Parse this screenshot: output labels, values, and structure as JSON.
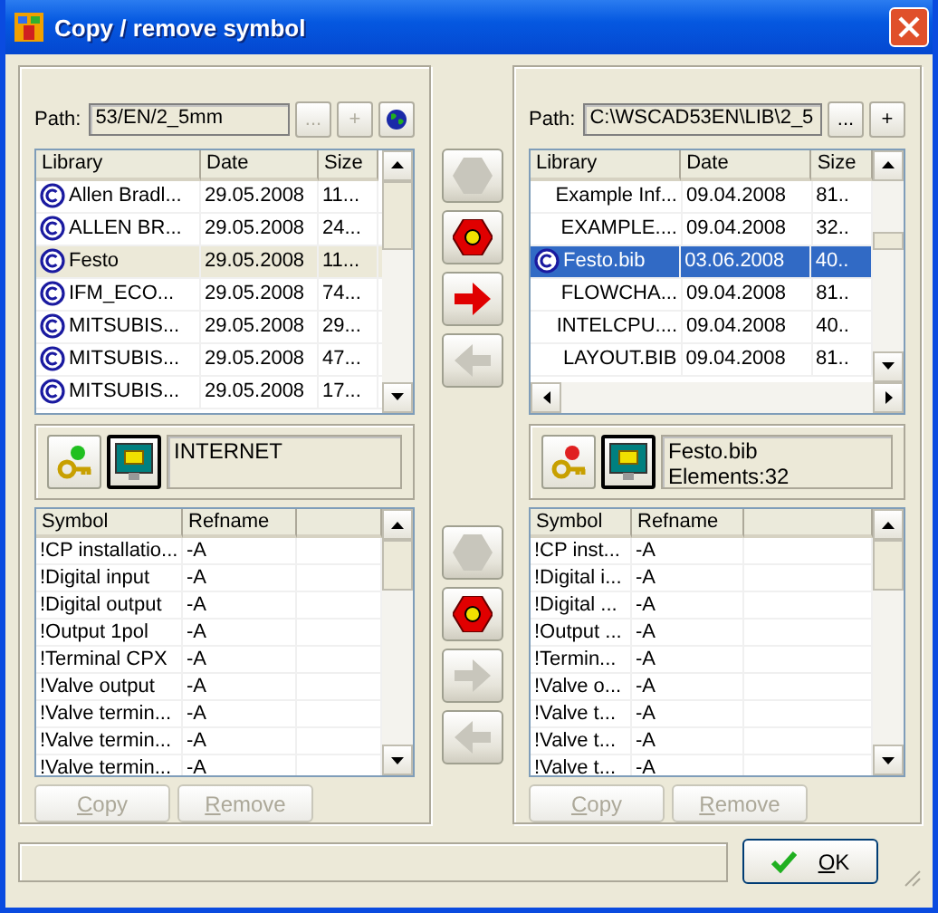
{
  "window": {
    "title": "Copy / remove symbol"
  },
  "left": {
    "path_label": "Path:",
    "path": "53/EN/2_5mm",
    "path_buttons": [
      {
        "kind": "text",
        "label": "...",
        "disabled": true
      },
      {
        "kind": "text",
        "label": "+",
        "disabled": true
      },
      {
        "kind": "globe",
        "disabled": false
      }
    ],
    "libraries": {
      "focused": false,
      "columns": [
        {
          "label": "Library"
        },
        {
          "label": "Date"
        },
        {
          "label": "Size"
        }
      ],
      "rows": [
        {
          "cells": [
            "Allen Bradl...",
            "29.05.2008",
            "11..."
          ],
          "marked": true,
          "selected": false
        },
        {
          "cells": [
            "ALLEN BR...",
            "29.05.2008",
            "24..."
          ],
          "marked": true,
          "selected": false
        },
        {
          "cells": [
            "Festo",
            "29.05.2008",
            "11..."
          ],
          "marked": true,
          "selected": true
        },
        {
          "cells": [
            "IFM_ECO...",
            "29.05.2008",
            "74..."
          ],
          "marked": true,
          "selected": false
        },
        {
          "cells": [
            "MITSUBIS...",
            "29.05.2008",
            "29..."
          ],
          "marked": true,
          "selected": false
        },
        {
          "cells": [
            "MITSUBIS...",
            "29.05.2008",
            "47..."
          ],
          "marked": true,
          "selected": false
        },
        {
          "cells": [
            "MITSUBIS...",
            "29.05.2008",
            "17..."
          ],
          "marked": true,
          "selected": false
        }
      ]
    },
    "info": {
      "color": "#20c020",
      "lines": [
        "INTERNET"
      ]
    },
    "symbols": {
      "columns": [
        {
          "label": "Symbol"
        },
        {
          "label": "Refname"
        }
      ],
      "rows": [
        {
          "cells": [
            "!CP installatio...",
            "-A"
          ]
        },
        {
          "cells": [
            "!Digital input",
            "-A"
          ]
        },
        {
          "cells": [
            "!Digital output",
            "-A"
          ]
        },
        {
          "cells": [
            "!Output 1pol",
            "-A"
          ]
        },
        {
          "cells": [
            "!Terminal CPX",
            "-A"
          ]
        },
        {
          "cells": [
            "!Valve output",
            "-A"
          ]
        },
        {
          "cells": [
            "!Valve termin...",
            "-A"
          ]
        },
        {
          "cells": [
            "!Valve termin...",
            "-A"
          ]
        },
        {
          "cells": [
            "!Valve termin...",
            "-A"
          ]
        }
      ]
    },
    "buttons": [
      {
        "label": "Copy",
        "disabled": true
      },
      {
        "label": "Remove",
        "disabled": true
      }
    ]
  },
  "transfer_top": [
    {
      "kind": "hexagon",
      "disabled": true
    },
    {
      "kind": "diamond",
      "disabled": false
    },
    {
      "kind": "arrow-right",
      "disabled": false
    },
    {
      "kind": "arrow-left",
      "disabled": true
    }
  ],
  "transfer_bottom": [
    {
      "kind": "hexagon",
      "disabled": true
    },
    {
      "kind": "diamond",
      "disabled": false
    },
    {
      "kind": "arrow-right",
      "disabled": true
    },
    {
      "kind": "arrow-left",
      "disabled": true
    }
  ],
  "right": {
    "path_label": "Path:",
    "path": "C:\\WSCAD53EN\\LIB\\2_5",
    "path_buttons": [
      {
        "kind": "text",
        "label": "...",
        "disabled": false
      },
      {
        "kind": "text",
        "label": "+",
        "disabled": false
      }
    ],
    "libraries": {
      "focused": true,
      "columns": [
        {
          "label": "Library"
        },
        {
          "label": "Date"
        },
        {
          "label": "Size"
        }
      ],
      "rows": [
        {
          "cells": [
            "Example Inf...",
            "09.04.2008",
            "81.."
          ],
          "marked": false,
          "selected": false
        },
        {
          "cells": [
            "EXAMPLE....",
            "09.04.2008",
            "32.."
          ],
          "marked": false,
          "selected": false
        },
        {
          "cells": [
            "Festo.bib",
            "03.06.2008",
            "40.."
          ],
          "marked": true,
          "selected": true
        },
        {
          "cells": [
            "FLOWCHA...",
            "09.04.2008",
            "81.."
          ],
          "marked": false,
          "selected": false
        },
        {
          "cells": [
            "INTELCPU....",
            "09.04.2008",
            "40.."
          ],
          "marked": false,
          "selected": false
        },
        {
          "cells": [
            "LAYOUT.BIB",
            "09.04.2008",
            "81.."
          ],
          "marked": false,
          "selected": false
        }
      ]
    },
    "info": {
      "color": "#e02020",
      "lines": [
        "Festo.bib",
        "Elements:32"
      ]
    },
    "symbols": {
      "columns": [
        {
          "label": "Symbol"
        },
        {
          "label": "Refname"
        }
      ],
      "rows": [
        {
          "cells": [
            "!CP inst...",
            "-A"
          ]
        },
        {
          "cells": [
            "!Digital i...",
            "-A"
          ]
        },
        {
          "cells": [
            "!Digital ...",
            "-A"
          ]
        },
        {
          "cells": [
            "!Output ...",
            "-A"
          ]
        },
        {
          "cells": [
            "!Termin...",
            "-A"
          ]
        },
        {
          "cells": [
            "!Valve o...",
            "-A"
          ]
        },
        {
          "cells": [
            "!Valve t...",
            "-A"
          ]
        },
        {
          "cells": [
            "!Valve t...",
            "-A"
          ]
        },
        {
          "cells": [
            "!Valve t...",
            "-A"
          ]
        }
      ]
    },
    "buttons": [
      {
        "label": "Copy",
        "disabled": true
      },
      {
        "label": "Remove",
        "disabled": true
      }
    ]
  },
  "ok_button": {
    "label": "OK"
  }
}
